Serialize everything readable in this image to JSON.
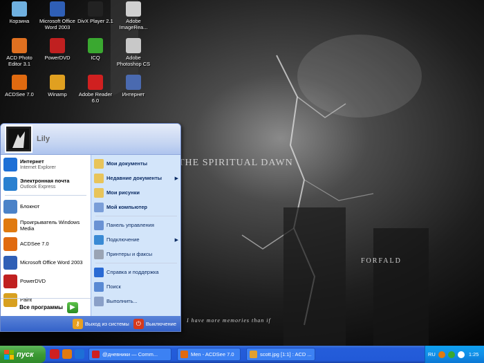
{
  "desktop": {
    "wallpaper_title": "THE SPIRITUAL DAWN",
    "wallpaper_band": "FORFALD",
    "wallpaper_quote": "I have more memories than if",
    "icons": [
      {
        "label": "Корзина",
        "icon": "recycle-bin-icon",
        "color": "#6fb0e0"
      },
      {
        "label": "Microsoft Office Word 2003",
        "icon": "word-icon",
        "color": "#2f5fb6"
      },
      {
        "label": "DivX Player 2.1",
        "icon": "divx-icon",
        "color": "#222"
      },
      {
        "label": "Adobe ImageRea...",
        "icon": "imageready-icon",
        "color": "#d0d0d0"
      },
      {
        "label": "ACD Photo Editor 3.1",
        "icon": "acd-photo-editor-icon",
        "color": "#e07020"
      },
      {
        "label": "PowerDVD",
        "icon": "powerdvd-icon",
        "color": "#c02020"
      },
      {
        "label": "ICQ",
        "icon": "icq-icon",
        "color": "#3aa830"
      },
      {
        "label": "Adobe Photoshop CS",
        "icon": "photoshop-icon",
        "color": "#c8c8c8"
      },
      {
        "label": "ACDSee 7.0",
        "icon": "acdsee-icon",
        "color": "#e06a10"
      },
      {
        "label": "Winamp",
        "icon": "winamp-icon",
        "color": "#e0a020"
      },
      {
        "label": "Adobe Reader 6.0",
        "icon": "adobe-reader-icon",
        "color": "#d02020"
      },
      {
        "label": "Интернет",
        "icon": "internet-icon",
        "color": "#4a6ab0"
      }
    ]
  },
  "start_menu": {
    "username": "Lily",
    "pinned": [
      {
        "title": "Интернет",
        "subtitle": "Internet Explorer",
        "icon": "internet-explorer-icon",
        "color": "#1d6fd6"
      },
      {
        "title": "Электронная почта",
        "subtitle": "Outlook Express",
        "icon": "outlook-express-icon",
        "color": "#2a80d0"
      }
    ],
    "recent": [
      {
        "title": "Блокнот",
        "icon": "notepad-icon",
        "color": "#4b82c8"
      },
      {
        "title": "Проигрыватель Windows Media",
        "icon": "media-player-icon",
        "color": "#e07a10"
      },
      {
        "title": "ACDSee 7.0",
        "icon": "acdsee-icon",
        "color": "#e06a10"
      },
      {
        "title": "Microsoft Office Word 2003",
        "icon": "word-icon",
        "color": "#2f5fb6"
      },
      {
        "title": "PowerDVD",
        "icon": "powerdvd-icon",
        "color": "#c02020"
      },
      {
        "title": "Paint",
        "icon": "paint-icon",
        "color": "#d8a020"
      }
    ],
    "all_programs": "Все программы",
    "right": [
      {
        "title": "Мои документы",
        "icon": "my-documents-icon",
        "color": "#e8c45a",
        "bold": true,
        "arrow": false
      },
      {
        "title": "Недавние документы",
        "icon": "recent-documents-icon",
        "color": "#e8c45a",
        "bold": true,
        "arrow": true
      },
      {
        "title": "Мои рисунки",
        "icon": "my-pictures-icon",
        "color": "#e8c45a",
        "bold": true,
        "arrow": false
      },
      {
        "title": "Мой компьютер",
        "icon": "my-computer-icon",
        "color": "#7a9ed8",
        "bold": true,
        "arrow": false
      },
      {
        "title": "Панель управления",
        "icon": "control-panel-icon",
        "color": "#6a92d4",
        "bold": false,
        "arrow": false
      },
      {
        "title": "Подключение",
        "icon": "connect-icon",
        "color": "#3a8ad4",
        "bold": false,
        "arrow": true
      },
      {
        "title": "Принтеры и факсы",
        "icon": "printers-icon",
        "color": "#9aa4b4",
        "bold": false,
        "arrow": false
      },
      {
        "title": "Справка и поддержка",
        "icon": "help-icon",
        "color": "#2a6ad4",
        "bold": false,
        "arrow": false
      },
      {
        "title": "Поиск",
        "icon": "search-icon",
        "color": "#5a8ad4",
        "bold": false,
        "arrow": false
      },
      {
        "title": "Выполнить...",
        "icon": "run-icon",
        "color": "#8aa0c8",
        "bold": false,
        "arrow": false
      }
    ],
    "logoff": "Выход из системы",
    "shutdown": "Выключение"
  },
  "taskbar": {
    "start_label": "пуск",
    "tasks": [
      {
        "title": "@дневники — Comm...",
        "icon": "opera-icon",
        "color": "#d02020"
      },
      {
        "title": "Men - ACDSee 7.0",
        "icon": "acdsee-icon",
        "color": "#e06a10"
      },
      {
        "title": "scott.jpg [1:1] : ACD ...",
        "icon": "acdsee-viewer-icon",
        "color": "#e0a030"
      }
    ],
    "language": "RU",
    "time": "1:25"
  }
}
